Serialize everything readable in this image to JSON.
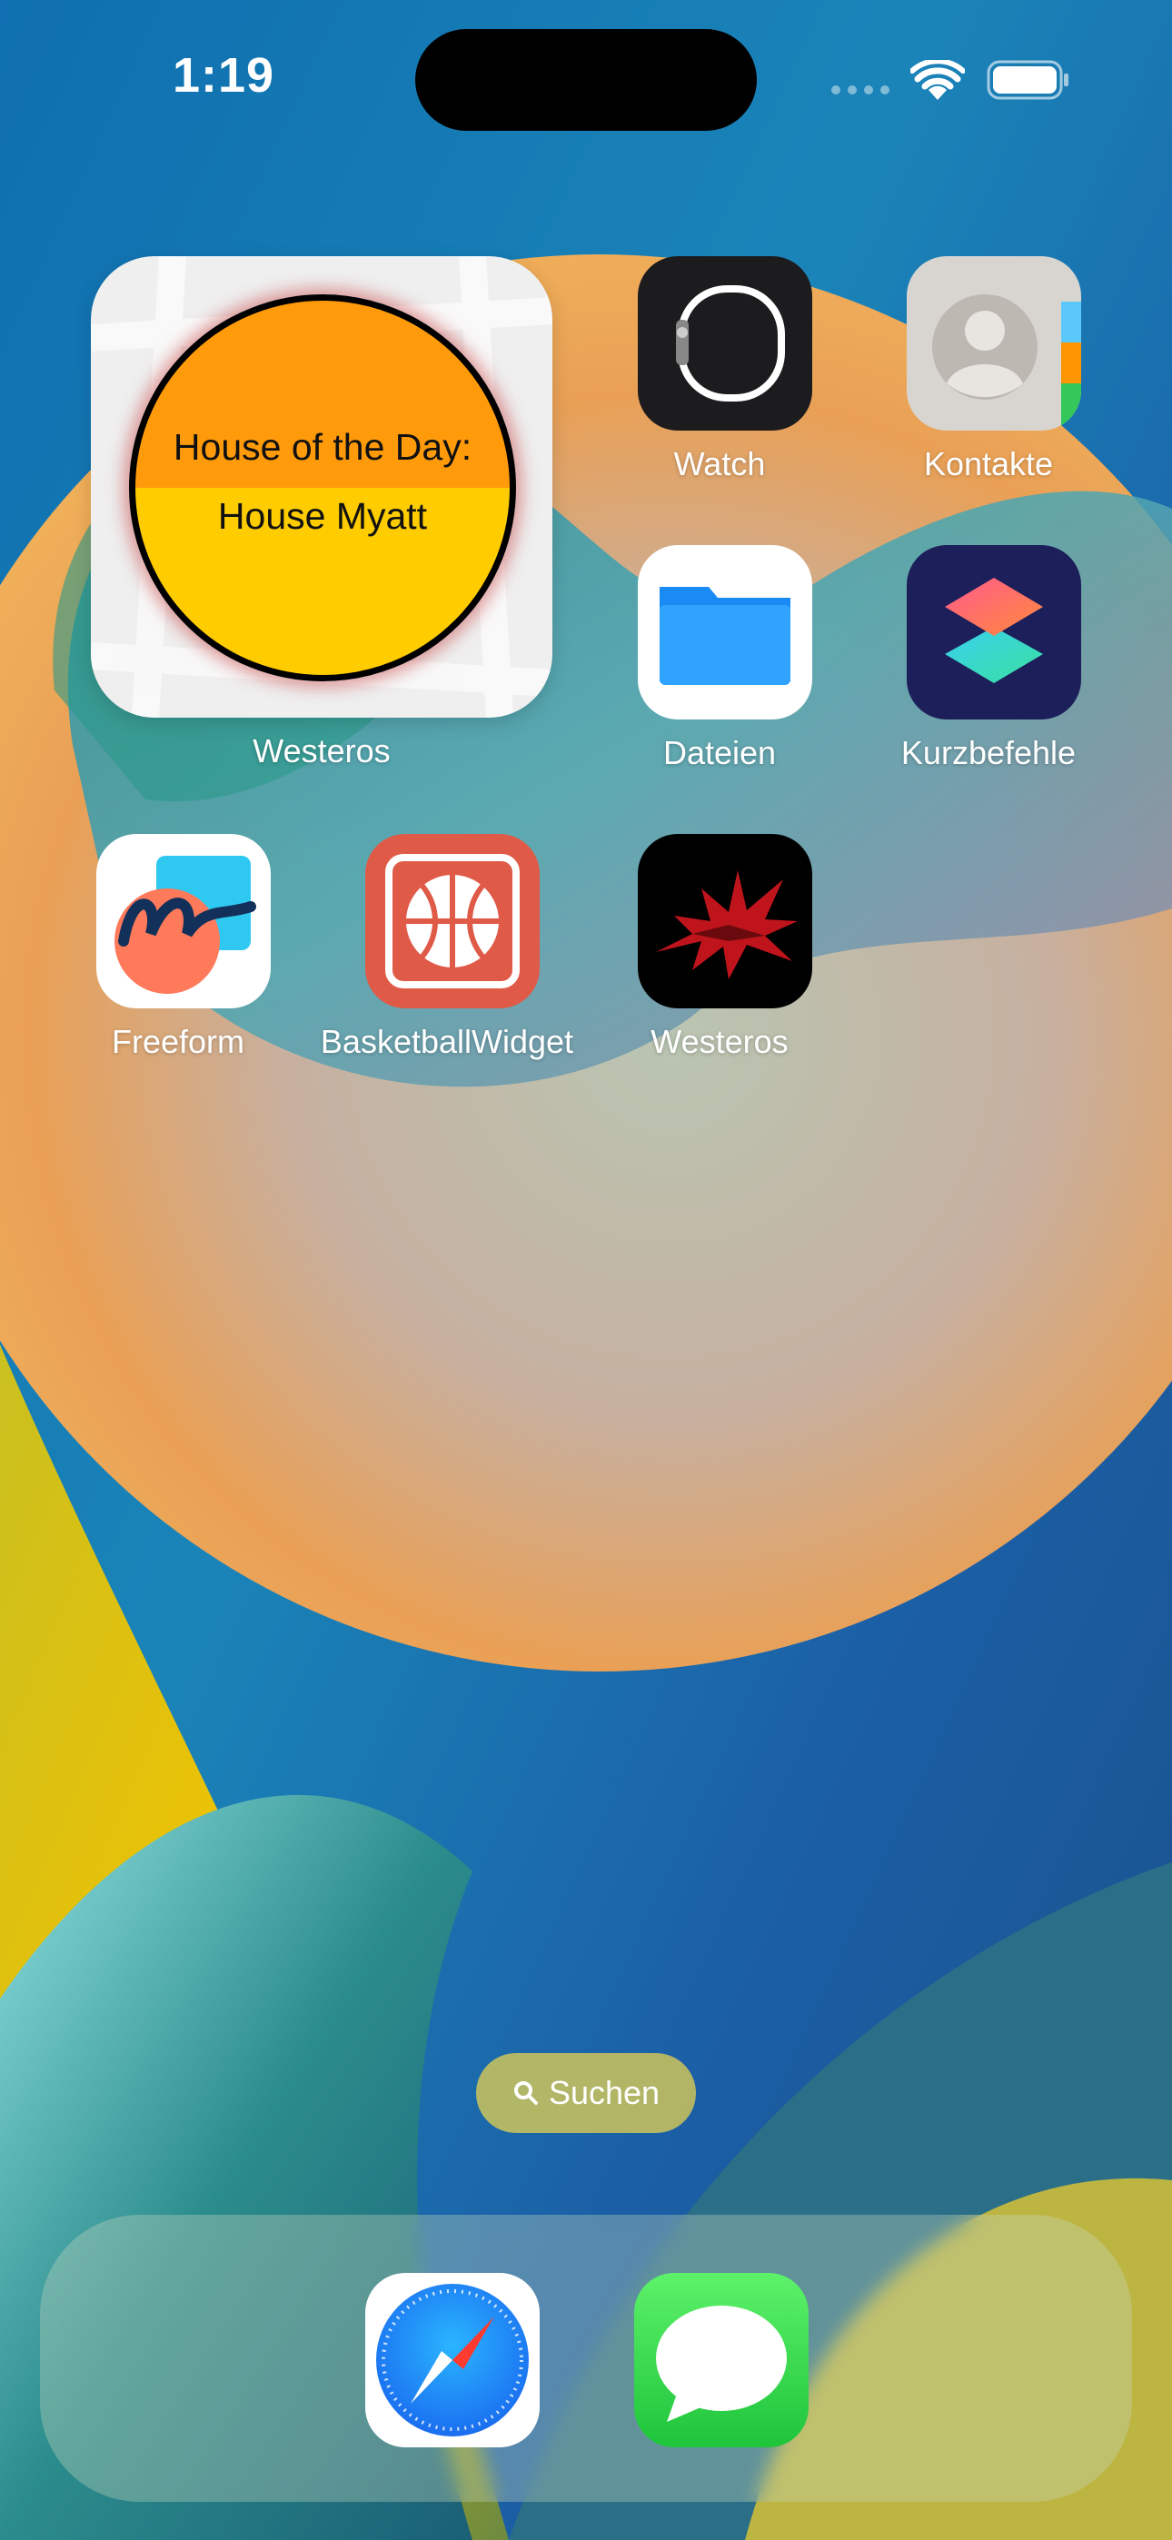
{
  "status_bar": {
    "time": "1:19",
    "wifi_icon": "wifi-icon",
    "battery_icon": "battery-icon"
  },
  "widget": {
    "line1": "House of the Day:",
    "line2": "House Myatt",
    "label": "Westeros"
  },
  "apps": [
    {
      "label": "Watch",
      "icon": "watch-icon"
    },
    {
      "label": "Kontakte",
      "icon": "contacts-icon"
    },
    {
      "label": "Dateien",
      "icon": "files-icon"
    },
    {
      "label": "Kurzbefehle",
      "icon": "shortcuts-icon"
    },
    {
      "label": "Freeform",
      "icon": "freeform-icon"
    },
    {
      "label": "BasketballWidget",
      "icon": "basketball-icon"
    },
    {
      "label": "Westeros",
      "icon": "dragon-icon"
    }
  ],
  "search": {
    "label": "Suchen",
    "icon": "search-icon"
  },
  "dock": [
    {
      "name": "Safari",
      "icon": "safari-icon"
    },
    {
      "name": "Nachrichten",
      "icon": "messages-icon"
    }
  ],
  "colors": {
    "wallpaper_blue": "#1a6fb4",
    "wallpaper_yellow": "#f2c200",
    "wallpaper_orange": "#eba05a",
    "disc_top": "#ff9b0a",
    "disc_bottom": "#ffcc00"
  }
}
